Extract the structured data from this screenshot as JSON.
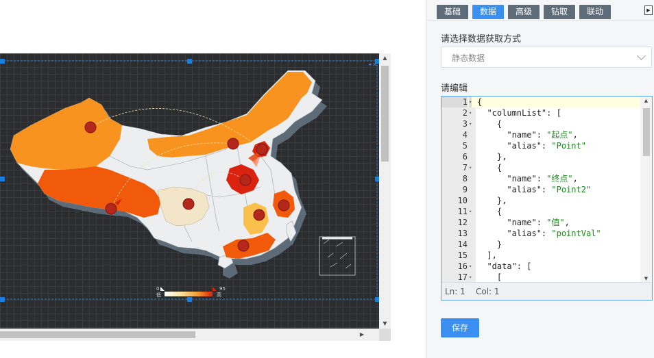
{
  "panel": {
    "tabs": [
      {
        "label": "基础",
        "active": false
      },
      {
        "label": "数据",
        "active": true
      },
      {
        "label": "高级",
        "active": false
      },
      {
        "label": "钻取",
        "active": false
      },
      {
        "label": "联动",
        "active": false
      }
    ],
    "source_label": "请选择数据获取方式",
    "source_value": "静态数据",
    "editor_label": "请编辑",
    "status_ln": "Ln: 1",
    "status_col": "Col: 1",
    "save_label": "保存"
  },
  "editor_lines": [
    {
      "n": "1",
      "fold": true,
      "text": "{"
    },
    {
      "n": "2",
      "fold": true,
      "text": "  \"columnList\": ["
    },
    {
      "n": "3",
      "fold": true,
      "text": "    {"
    },
    {
      "n": "4",
      "fold": false,
      "key": "      \"name\": ",
      "str": "\"起点\"",
      "tail": ","
    },
    {
      "n": "5",
      "fold": false,
      "key": "      \"alias\": ",
      "str": "\"Point\"",
      "tail": ""
    },
    {
      "n": "6",
      "fold": false,
      "text": "    },"
    },
    {
      "n": "7",
      "fold": true,
      "text": "    {"
    },
    {
      "n": "8",
      "fold": false,
      "key": "      \"name\": ",
      "str": "\"终点\"",
      "tail": ","
    },
    {
      "n": "9",
      "fold": false,
      "key": "      \"alias\": ",
      "str": "\"Point2\"",
      "tail": ""
    },
    {
      "n": "10",
      "fold": false,
      "text": "    },"
    },
    {
      "n": "11",
      "fold": true,
      "text": "    {"
    },
    {
      "n": "12",
      "fold": false,
      "key": "      \"name\": ",
      "str": "\"值\"",
      "tail": ","
    },
    {
      "n": "13",
      "fold": false,
      "key": "      \"alias\": ",
      "str": "\"pointVal\"",
      "tail": ""
    },
    {
      "n": "14",
      "fold": false,
      "text": "    }"
    },
    {
      "n": "15",
      "fold": false,
      "text": "  ],"
    },
    {
      "n": "16",
      "fold": true,
      "text": "  \"data\": ["
    },
    {
      "n": "17",
      "fold": true,
      "text": "    ["
    }
  ],
  "map_legend": {
    "min": "0",
    "max": "95",
    "min_sub": "低",
    "max_sub": "高"
  },
  "colors": {
    "accent": "#3b8ff0",
    "tab_inactive": "#5e6b78",
    "canvas_bg": "#2b2c2e",
    "map_base": "#eceef0",
    "map_shadow": "#5d6b78",
    "orange": "#f7931e",
    "orange_red": "#f05a0a",
    "red": "#d9230f",
    "pale": "#f3e6c8",
    "yellow": "#fbc04b"
  }
}
